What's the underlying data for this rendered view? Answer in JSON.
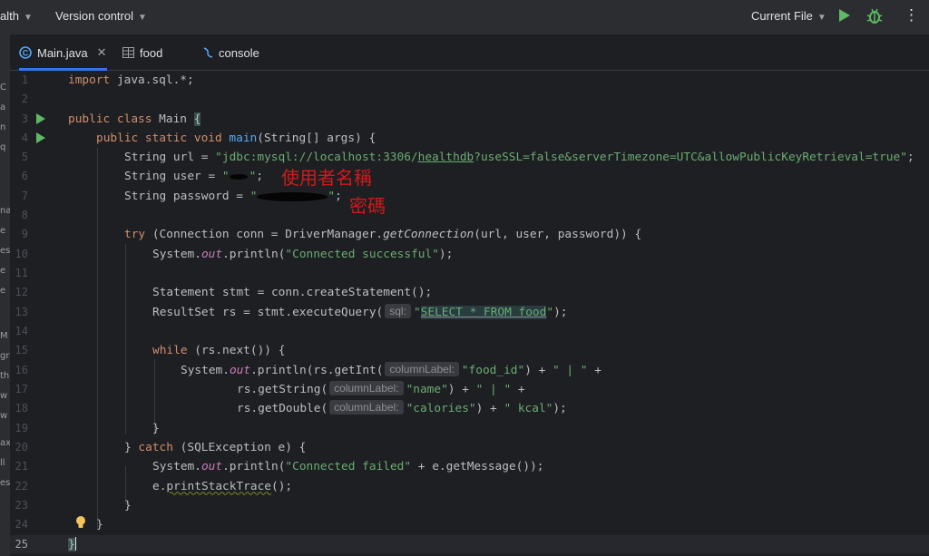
{
  "topbar": {
    "project_name": "alth",
    "vcs_label": "Version control",
    "run_config": "Current File"
  },
  "left_strip": [
    "C",
    "a",
    "n",
    "q",
    "na",
    "e",
    "es",
    "e",
    "e",
    "M",
    "gr",
    "th",
    "w",
    "w",
    "ax",
    "ll",
    "es"
  ],
  "tabs": [
    {
      "label": "Main.java",
      "icon": "java-class-icon",
      "active": true
    },
    {
      "label": "food",
      "icon": "table-icon",
      "active": false
    },
    {
      "label": "console",
      "icon": "console-icon",
      "active": false
    }
  ],
  "line_numbers": [
    "1",
    "2",
    "3",
    "4",
    "5",
    "6",
    "7",
    "8",
    "9",
    "10",
    "11",
    "12",
    "13",
    "14",
    "15",
    "16",
    "17",
    "18",
    "19",
    "20",
    "21",
    "22",
    "23",
    "24",
    "25"
  ],
  "code": {
    "l1_kw": "import",
    "l1_rest": " java.sql.*;",
    "l3_kw": "public class",
    "l3_rest": " Main ",
    "l3_brace": "{",
    "l4_kw": "public static void",
    "l4_fn": "main",
    "l4_rest": "(String[] args) {",
    "l5_decl": "String url = ",
    "l5_str_a": "\"jdbc:mysql://localhost:3306/",
    "l5_str_b": "healthdb",
    "l5_str_c": "?useSSL=false&serverTimezone=UTC&allowPublicKeyRetrieval=true\"",
    "l5_end": ";",
    "l6_decl": "String user = ",
    "l6_str_open": "\"",
    "l6_str_close": "\"",
    "l6_end": ";",
    "l7_decl": "String password = ",
    "l7_str_open": "\"",
    "l7_str_close": "\"",
    "l7_end": ";",
    "l9_kw": "try",
    "l9_a": " (Connection conn = DriverManager.",
    "l9_it": "getConnection",
    "l9_b": "(url, user, password)) {",
    "l10_a": "System.",
    "l10_st": "out",
    "l10_b": ".println(",
    "l10_str": "\"Connected successful\"",
    "l10_c": ");",
    "l12": "Statement stmt = conn.createStatement();",
    "l13_a": "ResultSet rs = stmt.executeQuery(",
    "l13_hint": "sql:",
    "l13_q1": "\"",
    "l13_sql": "SELECT * FROM food",
    "l13_q2": "\"",
    "l13_b": ");",
    "l15_kw": "while",
    "l15_rest": " (rs.next()) {",
    "l16_a": "System.",
    "l16_st": "out",
    "l16_b": ".println(rs.getInt(",
    "l16_hint": "columnLabel:",
    "l16_str": "\"food_id\"",
    "l16_c": ") + ",
    "l16_str2": "\" | \"",
    "l16_d": " +",
    "l17_a": "rs.getString(",
    "l17_hint": "columnLabel:",
    "l17_str": "\"name\"",
    "l17_b": ") + ",
    "l17_str2": "\" | \"",
    "l17_c": " +",
    "l18_a": "rs.getDouble(",
    "l18_hint": "columnLabel:",
    "l18_str": "\"calories\"",
    "l18_b": ") + ",
    "l18_str2": "\" kcal\"",
    "l18_c": ");",
    "l19": "}",
    "l20_a": "} ",
    "l20_kw": "catch",
    "l20_b": " (SQLException e) {",
    "l21_a": "System.",
    "l21_st": "out",
    "l21_b": ".println(",
    "l21_str": "\"Connected failed\"",
    "l21_c": " + e.getMessage());",
    "l22_a": "e.",
    "l22_fn": "printStackTrace",
    "l22_b": "();",
    "l23": "}",
    "l24": "}",
    "l25": "}"
  },
  "annotations": {
    "username": "使用者名稱",
    "password": "密碼"
  },
  "colors": {
    "background": "#1e1f22",
    "keyword": "#cf8e6d",
    "string": "#6aab73",
    "method": "#56a8f5",
    "static_field": "#c77dbb",
    "run": "#5fb865",
    "accent": "#3574f0",
    "annotation_ink": "#d11a1a"
  }
}
